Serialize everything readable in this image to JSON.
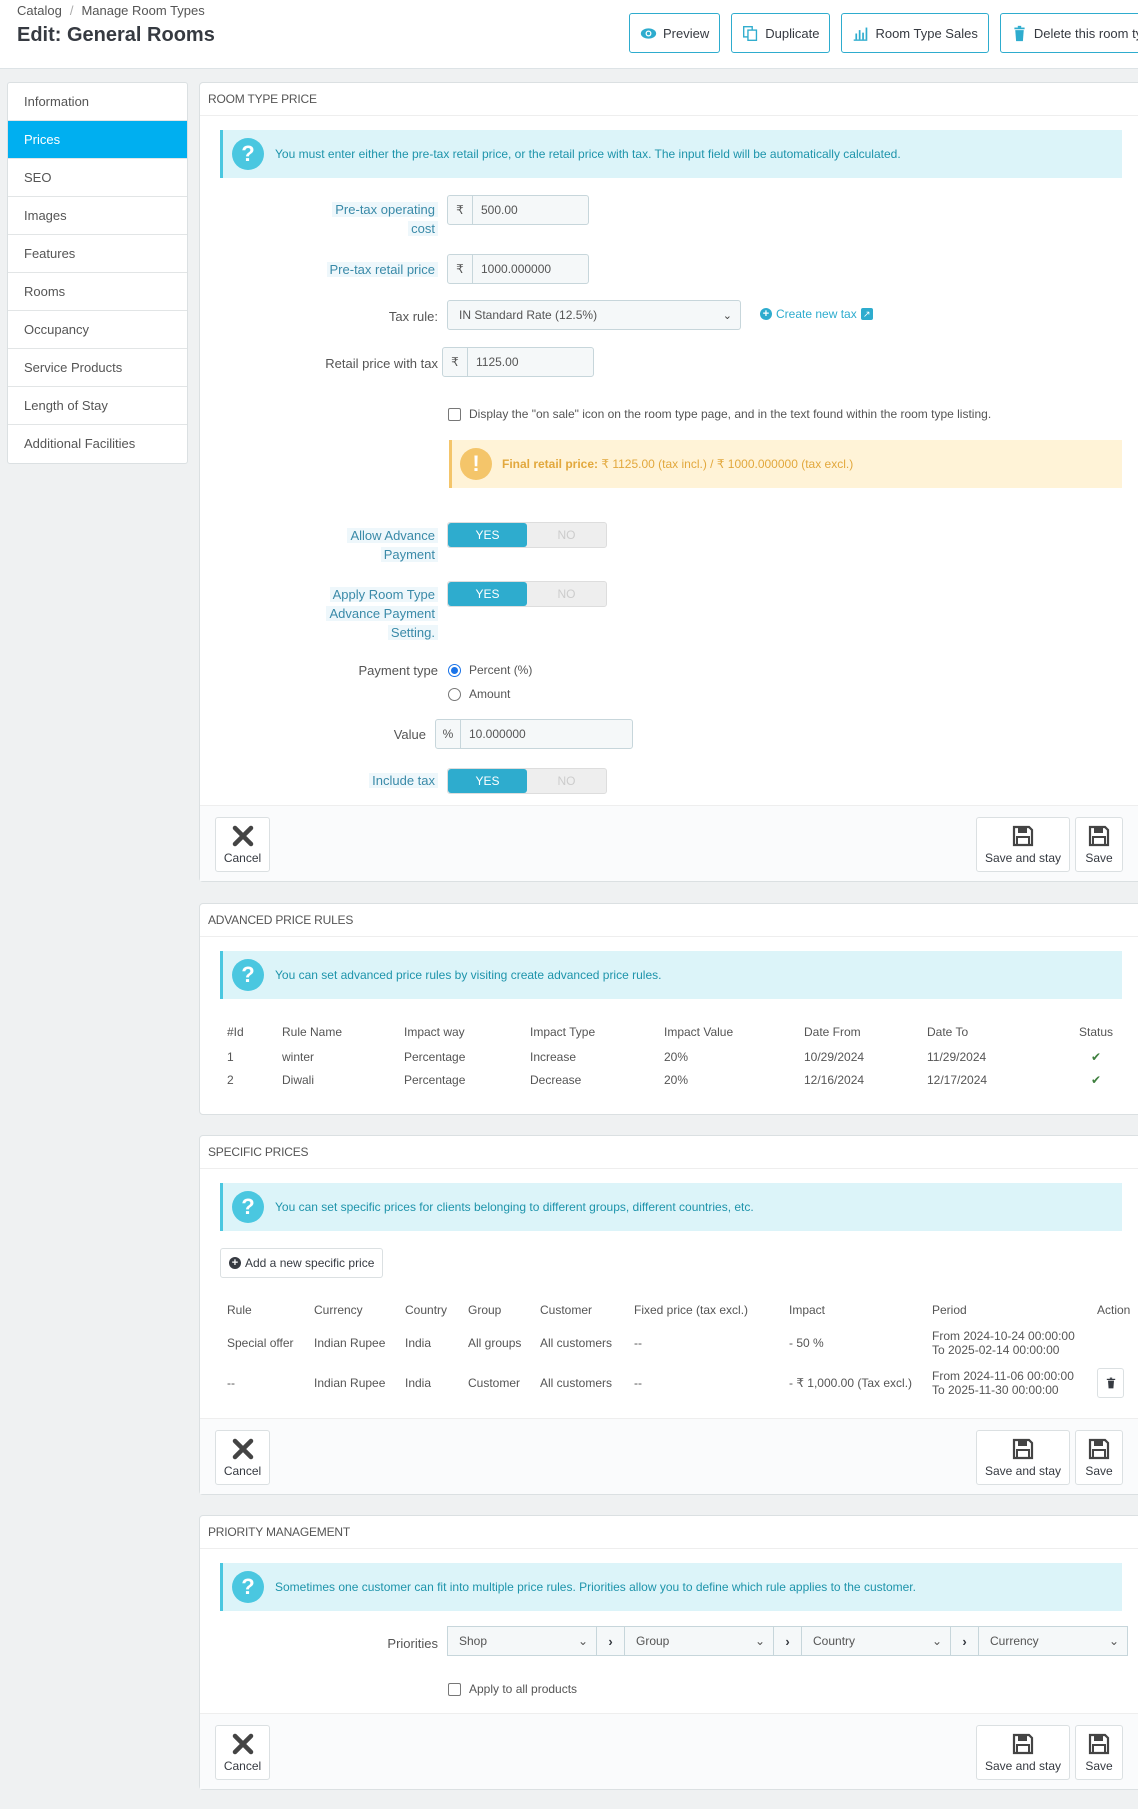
{
  "header": {
    "breadcrumb": [
      "Catalog",
      "Manage Room Types"
    ],
    "breadcrumb_sep": "/",
    "title": "Edit: General Rooms",
    "toolbar": {
      "preview": "Preview",
      "duplicate": "Duplicate",
      "sales": "Room Type Sales",
      "delete": "Delete this room type"
    }
  },
  "sidebar": {
    "active": "Prices",
    "items": [
      {
        "label": "Information"
      },
      {
        "label": "Prices"
      },
      {
        "label": "SEO"
      },
      {
        "label": "Images"
      },
      {
        "label": "Features"
      },
      {
        "label": "Rooms"
      },
      {
        "label": "Occupancy"
      },
      {
        "label": "Service Products"
      },
      {
        "label": "Length of Stay"
      },
      {
        "label": "Additional Facilities"
      }
    ]
  },
  "room_type_price": {
    "heading": "Room Type Price",
    "info": "You must enter either the pre-tax retail price, or the retail price with tax. The input field will be automatically calculated.",
    "currency_symbol": "₹",
    "pretax_cost_label_1": "Pre-tax operating",
    "pretax_cost_label_2": "cost",
    "pretax_cost_value": "500.00",
    "pretax_retail_label": "Pre-tax retail price",
    "pretax_retail_value": "1000.000000",
    "tax_rule_label": "Tax rule:",
    "tax_rule_value": "IN Standard Rate (12.5%)",
    "create_tax_link": "Create new tax",
    "retail_with_tax_label": "Retail price with tax",
    "retail_with_tax_value": "1125.00",
    "on_sale_label": "Display the \"on sale\" icon on the room type page, and in the text found within the room type listing.",
    "on_sale_checked": false,
    "final_price_label": "Final retail price:",
    "final_price_text": "₹ 1125.00 (tax incl.) / ₹ 1000.000000 (tax excl.)",
    "allow_advance_label_1": "Allow Advance",
    "allow_advance_label_2": "Payment",
    "allow_advance_value": "YES",
    "apply_setting_label_1": "Apply Room Type",
    "apply_setting_label_2": "Advance Payment",
    "apply_setting_label_3": "Setting.",
    "apply_setting_value": "YES",
    "yes": "YES",
    "no": "NO",
    "payment_type_label": "Payment type",
    "payment_options": [
      "Percent (%)",
      "Amount"
    ],
    "payment_selected": "Percent (%)",
    "value_label": "Value",
    "value_addon": "%",
    "value_value": "10.000000",
    "include_tax_label": "Include tax",
    "include_tax_value": "YES"
  },
  "footer": {
    "cancel": "Cancel",
    "save_and_stay": "Save and stay",
    "save": "Save"
  },
  "advanced_rules": {
    "heading": "Advanced Price Rules",
    "info_text": "You can set advanced price rules by visiting",
    "info_link": "create advanced price rules.",
    "columns": [
      "#Id",
      "Rule Name",
      "Impact way",
      "Impact Type",
      "Impact Value",
      "Date From",
      "Date To",
      "Status"
    ],
    "rows": [
      {
        "id": "1",
        "name": "winter",
        "way": "Percentage",
        "type": "Increase",
        "value": "20%",
        "from": "10/29/2024",
        "to": "11/29/2024",
        "status": "active"
      },
      {
        "id": "2",
        "name": "Diwali",
        "way": "Percentage",
        "type": "Decrease",
        "value": "20%",
        "from": "12/16/2024",
        "to": "12/17/2024",
        "status": "active"
      }
    ]
  },
  "specific_prices": {
    "heading": "Specific Prices",
    "info": "You can set specific prices for clients belonging to different groups, different countries, etc.",
    "add_button": "Add a new specific price",
    "columns": [
      "Rule",
      "Currency",
      "Country",
      "Group",
      "Customer",
      "Fixed price (tax excl.)",
      "Impact",
      "Period",
      "Action"
    ],
    "rows": [
      {
        "rule": "Special offer",
        "currency": "Indian Rupee",
        "country": "India",
        "group": "All groups",
        "customer": "All customers",
        "fixed": "--",
        "impact": "- 50 %",
        "period_from": "From 2024-10-24 00:00:00",
        "period_to": "To 2025-02-14 00:00:00",
        "deletable": false
      },
      {
        "rule": "--",
        "currency": "Indian Rupee",
        "country": "India",
        "group": "Customer",
        "customer": "All customers",
        "fixed": "--",
        "impact": "- ₹ 1,000.00 (Tax excl.)",
        "period_from": "From 2024-11-06 00:00:00",
        "period_to": "To 2025-11-30 00:00:00",
        "deletable": true
      }
    ]
  },
  "priority": {
    "heading": "Priority Management",
    "info": "Sometimes one customer can fit into multiple price rules. Priorities allow you to define which rule applies to the customer.",
    "label": "Priorities",
    "selects": [
      "Shop",
      "Group",
      "Country",
      "Currency"
    ],
    "apply_all_label": "Apply to all products",
    "apply_all_checked": false
  },
  "colors": {
    "accent": "#00aff0",
    "switch_on": "#2eacce",
    "info_bg": "#dcf4f9",
    "warn_bg": "#fff3d7",
    "status_ok": "#3e7f3e"
  }
}
